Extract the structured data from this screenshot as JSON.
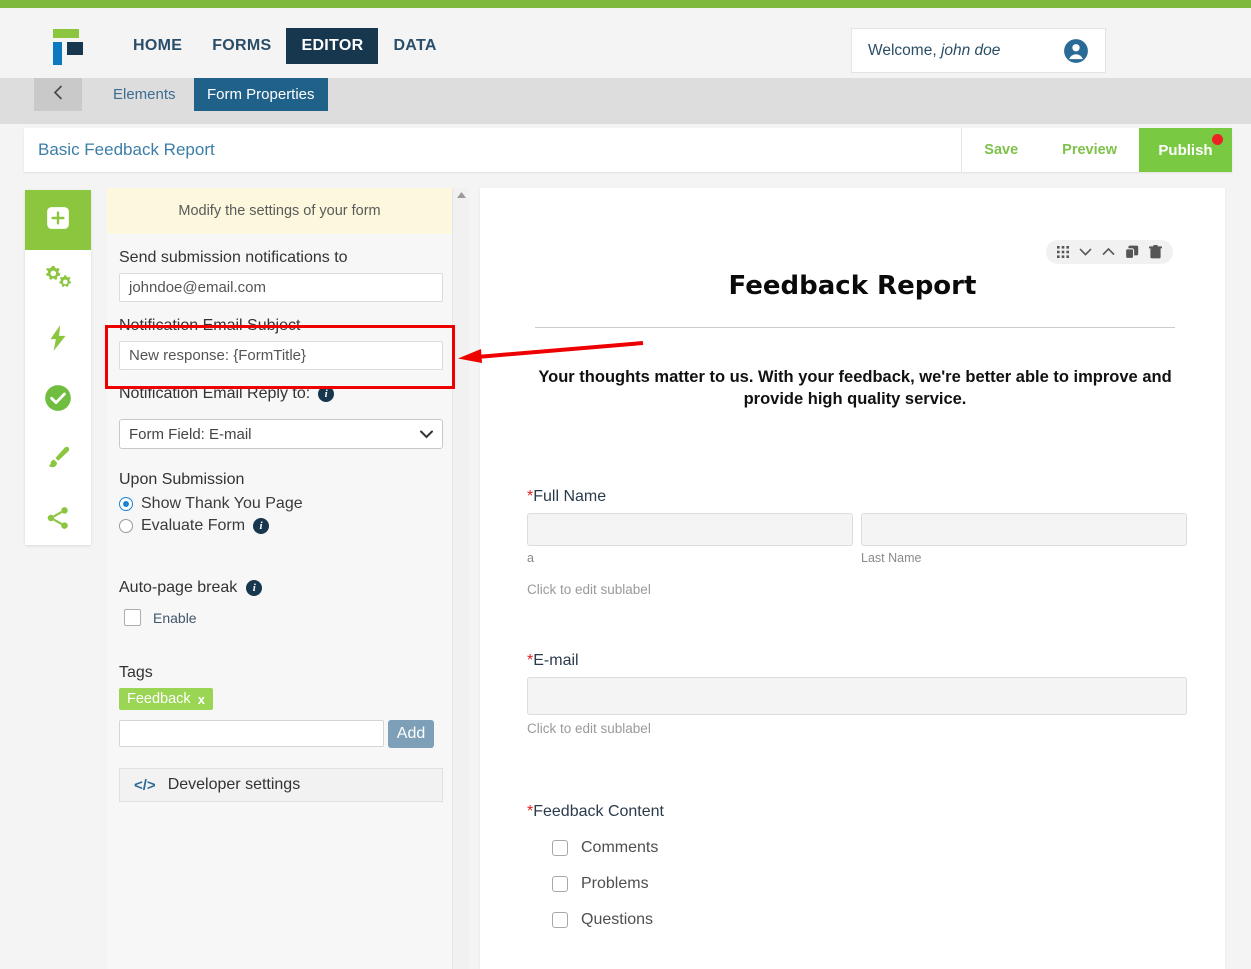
{
  "brand": {
    "accent_green": "#7fba3f",
    "navy": "#17374f",
    "blue": "#0b78bf",
    "publish_green": "#7ac943",
    "annotation_red": "#ee0000"
  },
  "navbar": {
    "logo_name": "jotform-logo",
    "links": [
      {
        "label": "HOME",
        "active": false
      },
      {
        "label": "FORMS",
        "active": false
      },
      {
        "label": "EDITOR",
        "active": true
      },
      {
        "label": "DATA",
        "active": false
      }
    ],
    "welcome_prefix": "Welcome,",
    "welcome_user": "john doe",
    "avatar_icon": "user-circle-icon"
  },
  "subnav": {
    "back_icon": "chevron-left-icon",
    "tabs": [
      {
        "label": "Elements",
        "active": false
      },
      {
        "label": "Form Properties",
        "active": true
      }
    ]
  },
  "titlebar": {
    "form_title": "Basic Feedback Report",
    "save_label": "Save",
    "preview_label": "Preview",
    "publish_label": "Publish",
    "publish_dot": true
  },
  "rail": {
    "items": [
      {
        "icon": "plus-square-icon",
        "name": "add-element",
        "active": true
      },
      {
        "icon": "gears-icon",
        "name": "form-settings",
        "active": false
      },
      {
        "icon": "bolt-icon",
        "name": "conditions",
        "active": false
      },
      {
        "icon": "check-circle-icon",
        "name": "thank-you",
        "active": false
      },
      {
        "icon": "paintbrush-icon",
        "name": "designer",
        "active": false
      },
      {
        "icon": "share-icon",
        "name": "publish-share",
        "active": false
      }
    ]
  },
  "panel": {
    "banner": "Modify the settings of your form",
    "notifications": {
      "label": "Send submission notifications to",
      "value": "johndoe@email.com",
      "placeholder": "johndoe@email.com"
    },
    "email_subject": {
      "label": "Notification Email Subject",
      "value": "New response: {FormTitle}",
      "placeholder": "New response: {FormTitle}"
    },
    "reply_to": {
      "label": "Notification Email Reply to:",
      "info_icon": "info-icon",
      "selected": "Form Field: E-mail",
      "chevron_icon": "chevron-down-icon"
    },
    "upon_submission": {
      "heading": "Upon Submission",
      "options": [
        {
          "label": "Show Thank You Page",
          "checked": true,
          "info": false
        },
        {
          "label": "Evaluate Form",
          "checked": false,
          "info": true
        }
      ]
    },
    "auto_page_break": {
      "heading": "Auto-page break",
      "info_icon": "info-icon",
      "checkbox_label": "Enable",
      "checked": false
    },
    "tags": {
      "heading": "Tags",
      "pills": [
        {
          "label": "Feedback",
          "remove": "x"
        }
      ],
      "input_value": "",
      "input_placeholder": "",
      "add_label": "Add"
    },
    "developer_settings": {
      "icon": "code-icon",
      "label": "Developer settings"
    },
    "scrollbar": {
      "up_arrow_icon": "triangle-up-icon"
    }
  },
  "preview": {
    "element_toolbar": [
      {
        "icon": "grid-drag-icon",
        "name": "drag-handle"
      },
      {
        "icon": "chevron-down-icon",
        "name": "move-down"
      },
      {
        "icon": "chevron-up-icon",
        "name": "move-up"
      },
      {
        "icon": "duplicate-icon",
        "name": "duplicate-element"
      },
      {
        "icon": "trash-icon",
        "name": "delete-element"
      }
    ],
    "heading": "Feedback Report",
    "subheading": "Your thoughts matter to us. With your feedback, we're better able to improve and provide high quality service.",
    "fields": [
      {
        "label": "Full Name",
        "required": true,
        "type": "name",
        "inputs": [
          {
            "value": "",
            "sublabel": "a"
          },
          {
            "value": "",
            "sublabel": "Last Name"
          }
        ],
        "edit_sublabel": "Click to edit sublabel"
      },
      {
        "label": "E-mail",
        "required": true,
        "type": "email",
        "inputs": [
          {
            "value": "",
            "sublabel": ""
          }
        ],
        "edit_sublabel": "Click to edit sublabel"
      },
      {
        "label": "Feedback Content",
        "required": true,
        "type": "checkbox-group",
        "options": [
          {
            "label": "Comments",
            "checked": false
          },
          {
            "label": "Problems",
            "checked": false
          },
          {
            "label": "Questions",
            "checked": false
          }
        ]
      }
    ]
  },
  "annotation": {
    "highlight_target": "notification-email-subject-field",
    "arrow_direction": "left"
  }
}
